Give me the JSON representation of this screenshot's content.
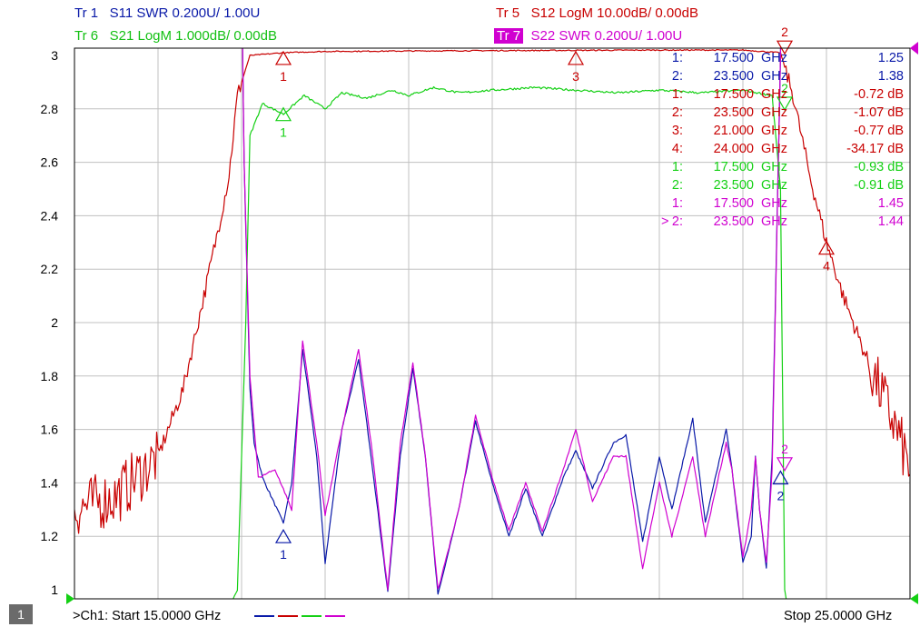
{
  "traces_header": [
    {
      "tr": "Tr 1",
      "label": "S11 SWR 0.200U/  1.00U",
      "color": "#0a1aa8",
      "selected": false
    },
    {
      "tr": "Tr 5",
      "label": "S12 LogM 10.00dB/  0.00dB",
      "color": "#c80000",
      "selected": false
    },
    {
      "tr": "Tr 6",
      "label": "S21 LogM 1.000dB/  0.00dB",
      "color": "#00c000",
      "selected": false
    },
    {
      "tr": "Tr 7",
      "label": "S22 SWR 0.200U/  1.00U",
      "color": "#d000d0",
      "selected": true
    }
  ],
  "colors": {
    "s11": "#0a1aa8",
    "s12": "#c80000",
    "s21": "#14d014",
    "s22": "#d000d0",
    "grid": "#c0c0c0",
    "frame": "#000000"
  },
  "chart_data": {
    "type": "line",
    "x_range_ghz": [
      15.0,
      25.0
    ],
    "y_range": [
      1.0,
      3.0
    ],
    "y_ticks": [
      "3",
      "2.8",
      "2.6",
      "2.4",
      "2.2",
      "2",
      "1.8",
      "1.6",
      "1.4",
      "1.2",
      "1"
    ],
    "grid": true,
    "series": [
      {
        "name": "S11 SWR",
        "color": "#0a1aa8",
        "points": [
          [
            15.0,
            4.5
          ],
          [
            16.95,
            4.5
          ],
          [
            17.03,
            2.6
          ],
          [
            17.1,
            1.75
          ],
          [
            17.15,
            1.55
          ],
          [
            17.25,
            1.42
          ],
          [
            17.5,
            1.25
          ],
          [
            17.6,
            1.4
          ],
          [
            17.73,
            1.9
          ],
          [
            17.9,
            1.5
          ],
          [
            18.0,
            1.1
          ],
          [
            18.2,
            1.6
          ],
          [
            18.4,
            1.86
          ],
          [
            18.55,
            1.5
          ],
          [
            18.75,
            0.99
          ],
          [
            18.9,
            1.5
          ],
          [
            19.05,
            1.83
          ],
          [
            19.2,
            1.5
          ],
          [
            19.35,
            0.98
          ],
          [
            19.6,
            1.3
          ],
          [
            19.8,
            1.63
          ],
          [
            20.0,
            1.4
          ],
          [
            20.2,
            1.2
          ],
          [
            20.4,
            1.38
          ],
          [
            20.6,
            1.2
          ],
          [
            20.85,
            1.42
          ],
          [
            21.0,
            1.52
          ],
          [
            21.2,
            1.38
          ],
          [
            21.45,
            1.55
          ],
          [
            21.6,
            1.58
          ],
          [
            21.8,
            1.18
          ],
          [
            22.0,
            1.5
          ],
          [
            22.15,
            1.3
          ],
          [
            22.4,
            1.64
          ],
          [
            22.55,
            1.25
          ],
          [
            22.8,
            1.6
          ],
          [
            22.87,
            1.45
          ],
          [
            23.0,
            1.1
          ],
          [
            23.1,
            1.2
          ],
          [
            23.15,
            1.5
          ],
          [
            23.2,
            1.3
          ],
          [
            23.28,
            1.08
          ],
          [
            23.35,
            1.5
          ],
          [
            23.45,
            3.0
          ],
          [
            23.5,
            4.5
          ],
          [
            25.0,
            4.5
          ]
        ]
      },
      {
        "name": "S12 LogM",
        "color": "#c80000",
        "points": [
          [
            15.0,
            1.3
          ],
          [
            15.5,
            1.35
          ],
          [
            16.0,
            1.5
          ],
          [
            16.3,
            1.75
          ],
          [
            16.55,
            2.1
          ],
          [
            16.7,
            2.32
          ],
          [
            16.85,
            2.55
          ],
          [
            16.95,
            2.85
          ],
          [
            17.1,
            3.0
          ],
          [
            17.5,
            3.01
          ],
          [
            18.0,
            3.015
          ],
          [
            20.0,
            3.018
          ],
          [
            22.0,
            3.02
          ],
          [
            23.0,
            3.02
          ],
          [
            23.45,
            3.01
          ],
          [
            23.6,
            2.85
          ],
          [
            23.8,
            2.55
          ],
          [
            24.0,
            2.3
          ],
          [
            24.2,
            2.1
          ],
          [
            24.5,
            1.85
          ],
          [
            24.8,
            1.63
          ],
          [
            25.0,
            1.45
          ]
        ]
      },
      {
        "name": "S21 LogM",
        "color": "#14d014",
        "points": [
          [
            15.0,
            0.9
          ],
          [
            16.8,
            0.9
          ],
          [
            16.95,
            1.0
          ],
          [
            17.05,
            2.0
          ],
          [
            17.1,
            2.7
          ],
          [
            17.25,
            2.82
          ],
          [
            17.5,
            2.78
          ],
          [
            17.75,
            2.85
          ],
          [
            18.0,
            2.8
          ],
          [
            18.2,
            2.86
          ],
          [
            18.5,
            2.84
          ],
          [
            18.8,
            2.87
          ],
          [
            19.0,
            2.85
          ],
          [
            19.3,
            2.88
          ],
          [
            19.6,
            2.86
          ],
          [
            20.0,
            2.87
          ],
          [
            20.5,
            2.88
          ],
          [
            21.0,
            2.87
          ],
          [
            21.5,
            2.86
          ],
          [
            22.0,
            2.87
          ],
          [
            22.5,
            2.86
          ],
          [
            23.0,
            2.87
          ],
          [
            23.35,
            2.85
          ],
          [
            23.45,
            2.5
          ],
          [
            23.5,
            1.0
          ],
          [
            23.55,
            0.9
          ],
          [
            25.0,
            0.9
          ]
        ]
      },
      {
        "name": "S22 SWR",
        "color": "#d000d0",
        "points": [
          [
            15.0,
            4.5
          ],
          [
            16.95,
            4.5
          ],
          [
            17.03,
            2.6
          ],
          [
            17.1,
            1.8
          ],
          [
            17.2,
            1.42
          ],
          [
            17.4,
            1.45
          ],
          [
            17.6,
            1.3
          ],
          [
            17.73,
            1.93
          ],
          [
            17.9,
            1.55
          ],
          [
            18.0,
            1.28
          ],
          [
            18.2,
            1.6
          ],
          [
            18.4,
            1.9
          ],
          [
            18.55,
            1.55
          ],
          [
            18.75,
            1.0
          ],
          [
            18.9,
            1.55
          ],
          [
            19.05,
            1.85
          ],
          [
            19.2,
            1.5
          ],
          [
            19.35,
            1.0
          ],
          [
            19.6,
            1.3
          ],
          [
            19.8,
            1.65
          ],
          [
            20.0,
            1.42
          ],
          [
            20.2,
            1.22
          ],
          [
            20.4,
            1.4
          ],
          [
            20.6,
            1.22
          ],
          [
            20.85,
            1.45
          ],
          [
            21.0,
            1.6
          ],
          [
            21.2,
            1.33
          ],
          [
            21.45,
            1.5
          ],
          [
            21.6,
            1.5
          ],
          [
            21.8,
            1.08
          ],
          [
            22.0,
            1.4
          ],
          [
            22.15,
            1.2
          ],
          [
            22.4,
            1.5
          ],
          [
            22.55,
            1.2
          ],
          [
            22.8,
            1.55
          ],
          [
            22.87,
            1.45
          ],
          [
            23.0,
            1.12
          ],
          [
            23.1,
            1.3
          ],
          [
            23.15,
            1.5
          ],
          [
            23.2,
            1.3
          ],
          [
            23.28,
            1.1
          ],
          [
            23.35,
            1.45
          ],
          [
            23.45,
            3.0
          ],
          [
            23.5,
            4.5
          ],
          [
            25.0,
            4.5
          ]
        ]
      }
    ],
    "markers_on_trace": [
      {
        "label": "1",
        "color": "#c80000",
        "x": 17.5,
        "y": 2.99,
        "type": "up"
      },
      {
        "label": "3",
        "color": "#c80000",
        "x": 21.0,
        "y": 2.99,
        "type": "up"
      },
      {
        "label": "4",
        "color": "#c80000",
        "x": 24.0,
        "y": 2.28,
        "type": "up"
      },
      {
        "label": "2",
        "color": "#c80000",
        "x": 23.5,
        "y": 3.03,
        "type": "down"
      },
      {
        "label": "1",
        "color": "#14d014",
        "x": 17.5,
        "y": 2.78,
        "type": "up"
      },
      {
        "label": "1",
        "color": "#0a1aa8",
        "x": 17.5,
        "y": 1.2,
        "type": "up"
      },
      {
        "label": "2",
        "color": "#d000d0",
        "x": 23.5,
        "y": 1.47,
        "type": "down"
      },
      {
        "label": "2",
        "color": "#0a1aa8",
        "x": 23.45,
        "y": 1.42,
        "type": "up"
      },
      {
        "label": "2",
        "color": "#14d014",
        "x": 23.5,
        "y": 2.82,
        "type": "down"
      }
    ],
    "marker_table": [
      {
        "id": "1:",
        "freq": "17.500",
        "unit": "GHz",
        "value": "1.25",
        "color": "#0a1aa8",
        "active": false
      },
      {
        "id": "2:",
        "freq": "23.500",
        "unit": "GHz",
        "value": "1.38",
        "color": "#0a1aa8",
        "active": false
      },
      {
        "id": "1:",
        "freq": "17.500",
        "unit": "GHz",
        "value": "-0.72 dB",
        "color": "#c80000",
        "active": false
      },
      {
        "id": "2:",
        "freq": "23.500",
        "unit": "GHz",
        "value": "-1.07 dB",
        "color": "#c80000",
        "active": false
      },
      {
        "id": "3:",
        "freq": "21.000",
        "unit": "GHz",
        "value": "-0.77 dB",
        "color": "#c80000",
        "active": false
      },
      {
        "id": "4:",
        "freq": "24.000",
        "unit": "GHz",
        "value": "-34.17 dB",
        "color": "#c80000",
        "active": false
      },
      {
        "id": "1:",
        "freq": "17.500",
        "unit": "GHz",
        "value": "-0.93 dB",
        "color": "#14d014",
        "active": false
      },
      {
        "id": "2:",
        "freq": "23.500",
        "unit": "GHz",
        "value": "-0.91 dB",
        "color": "#14d014",
        "active": false
      },
      {
        "id": "1:",
        "freq": "17.500",
        "unit": "GHz",
        "value": "1.45",
        "color": "#d000d0",
        "active": false
      },
      {
        "id": "2:",
        "freq": "23.500",
        "unit": "GHz",
        "value": "1.44",
        "color": "#d000d0",
        "active": true
      }
    ],
    "active_marker_symbol": ">"
  },
  "footer": {
    "channel_num": "1",
    "start_label": ">Ch1:  Start  15.0000 GHz",
    "stop_label": "Stop  25.0000 GHz",
    "swatch_colors": [
      "#0a1aa8",
      "#c80000",
      "#14d014",
      "#d000d0"
    ]
  }
}
